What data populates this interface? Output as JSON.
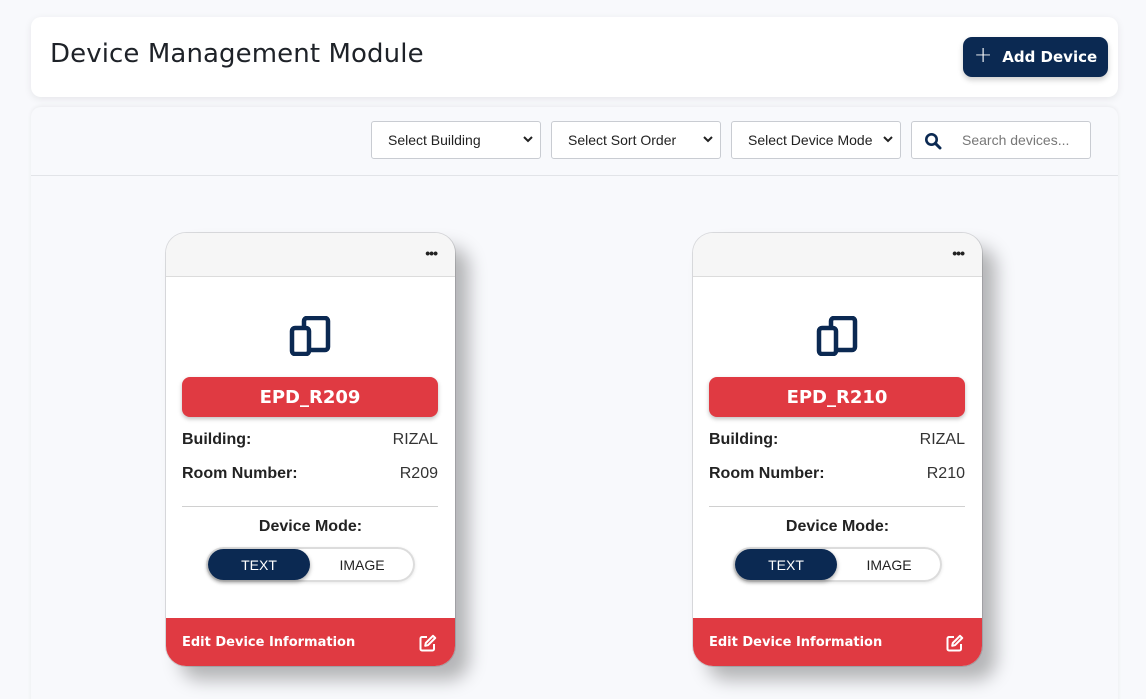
{
  "header": {
    "title": "Device Management Module",
    "add_button": {
      "icon": "plus-icon",
      "label": "Add Device"
    }
  },
  "filters": {
    "building": {
      "selected": "Select Building"
    },
    "sort": {
      "selected": "Select Sort Order"
    },
    "mode": {
      "selected": "Select Device Mode"
    },
    "search": {
      "icon": "search-icon",
      "placeholder": "Search devices...",
      "value": ""
    }
  },
  "devices": [
    {
      "name": "EPD_R209",
      "building_label": "Building:",
      "building": "RIZAL",
      "room_label": "Room Number:",
      "room": "R209",
      "mode_label": "Device Mode:",
      "mode_options": [
        "TEXT",
        "IMAGE"
      ],
      "mode_selected": "TEXT",
      "footer_label": "Edit Device Information",
      "menu_icon": "more-horizontal-icon",
      "device_icon": "devices-icon",
      "edit_icon": "edit-icon"
    },
    {
      "name": "EPD_R210",
      "building_label": "Building:",
      "building": "RIZAL",
      "room_label": "Room Number:",
      "room": "R210",
      "mode_label": "Device Mode:",
      "mode_options": [
        "TEXT",
        "IMAGE"
      ],
      "mode_selected": "TEXT",
      "footer_label": "Edit Device Information",
      "menu_icon": "more-horizontal-icon",
      "device_icon": "devices-icon",
      "edit_icon": "edit-icon"
    }
  ],
  "colors": {
    "primary": "#0b2952",
    "accent": "#e03a42",
    "background": "#f8f9fc"
  }
}
